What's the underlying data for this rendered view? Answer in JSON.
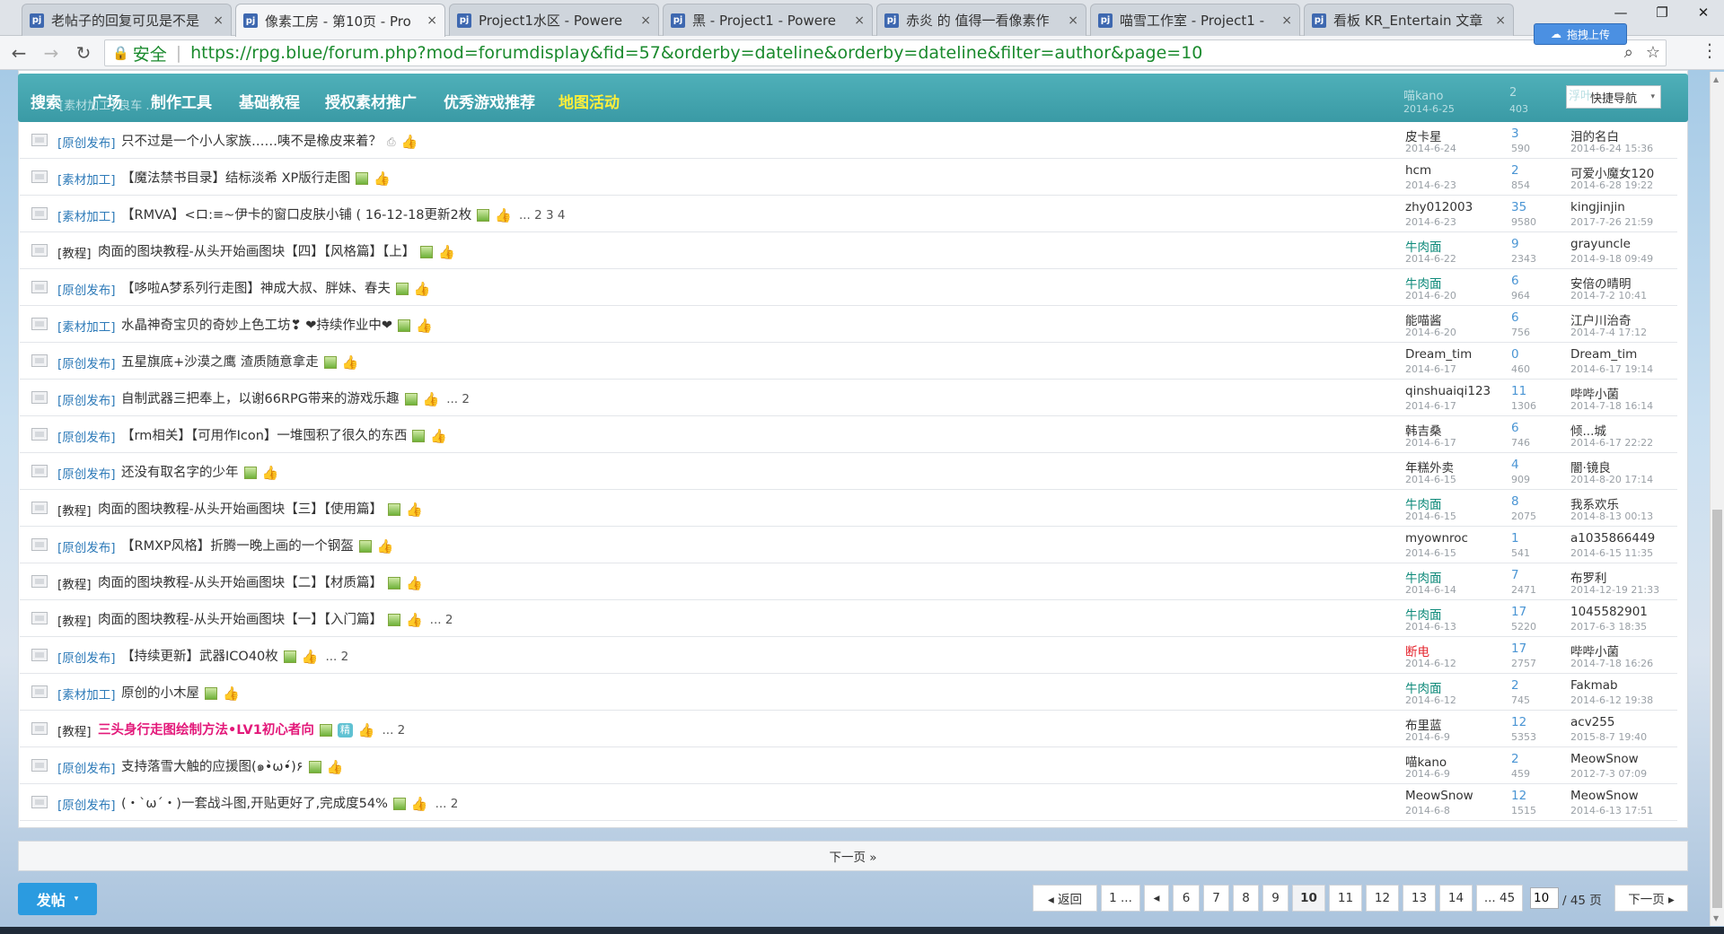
{
  "browser": {
    "tabs": [
      {
        "title": "老帖子的回复可见是不是"
      },
      {
        "title": "像素工房 - 第10页 - Pro",
        "active": true
      },
      {
        "title": "Project1水区 - Powere"
      },
      {
        "title": "黑 - Project1 - Powere"
      },
      {
        "title": "赤炎 的 值得一看像素作"
      },
      {
        "title": "喵雪工作室 - Project1 -"
      },
      {
        "title": "看板 KR_Entertain 文章"
      }
    ],
    "favicon": "pj",
    "close_glyph": "×",
    "window_controls": [
      "—",
      "❐",
      "✕"
    ],
    "upload_label": "拖拽上传",
    "back_glyph": "←",
    "forward_glyph": "→",
    "reload_glyph": "↻",
    "lock_glyph": "🔒",
    "secure_label": "安全",
    "url": "https://rpg.blue/forum.php?mod=forumdisplay&fid=57&orderby=dateline&orderby=dateline&filter=author&page=10",
    "search_glyph": "⌕",
    "star_glyph": "☆",
    "menu_glyph": "⋮"
  },
  "nav": {
    "items": [
      "搜索",
      "广场",
      "制作工具",
      "基础教程",
      "授权素材推广",
      "优秀游戏推荐",
      "地图活动"
    ],
    "quick_nav": "快捷导航",
    "ghost_top": [
      {
        "text": "喵kano",
        "kind": "au"
      },
      {
        "text": "2014-6-25",
        "kind": "ad"
      },
      {
        "text": "2",
        "kind": "rc"
      },
      {
        "text": "403",
        "kind": "vc"
      },
      {
        "text": "浮叶",
        "kind": "lu"
      },
      {
        "text": "[素材加工] 良车 ...",
        "kind": "cat"
      }
    ]
  },
  "threads": [
    {
      "cat": "[原创发布]",
      "subject": "只不过是一个小人家族……咦不是橡皮来着？",
      "marks": [
        "clip",
        "thumb"
      ],
      "author": "皮卡星",
      "date": "2014-6-24",
      "replies": "3",
      "views": "590",
      "last_user": "泪的名白",
      "last_time": "2014-6-24 15:36"
    },
    {
      "cat": "[素材加工]",
      "subject": "【魔法禁书目录】结标淡希 XP版行走图",
      "marks": [
        "img",
        "thumb"
      ],
      "author": "hcm",
      "date": "2014-6-23",
      "replies": "2",
      "views": "854",
      "last_user": "可爱小魔女120",
      "last_time": "2014-6-28 19:22"
    },
    {
      "cat": "[素材加工]",
      "subject": "【RMVA】<ロ:≡~伊卡的窗口皮肤小铺 ( 16-12-18更新2枚",
      "marks": [
        "img",
        "thumb"
      ],
      "pages": "... 2 3 4",
      "author": "zhy012003",
      "date": "2014-6-23",
      "replies": "35",
      "views": "9580",
      "last_user": "kingjinjin",
      "last_time": "2017-7-26 21:59"
    },
    {
      "cat": "[教程]",
      "subject": "肉面的图块教程-从头开始画图块【四】【风格篇】【上】",
      "marks": [
        "img",
        "thumb"
      ],
      "author": "牛肉面",
      "author_color": "teal",
      "date": "2014-6-22",
      "replies": "9",
      "views": "2343",
      "last_user": "grayuncle",
      "last_time": "2014-9-18 09:49"
    },
    {
      "cat": "[原创发布]",
      "subject": "【哆啦A梦系列行走图】神成大叔、胖妹、春夫",
      "marks": [
        "img",
        "thumb"
      ],
      "author": "牛肉面",
      "author_color": "teal",
      "date": "2014-6-20",
      "replies": "6",
      "views": "964",
      "last_user": "安倍の晴明",
      "last_time": "2014-7-2 10:41"
    },
    {
      "cat": "[素材加工]",
      "subject": "水晶神奇宝贝的奇妙上色工坊❣ ❤持续作业中❤",
      "marks": [
        "img",
        "thumb"
      ],
      "author": "能喵酱",
      "date": "2014-6-20",
      "replies": "6",
      "views": "756",
      "last_user": "江户川治奇",
      "last_time": "2014-7-4 17:12"
    },
    {
      "cat": "[原创发布]",
      "subject": "五星旗底+沙漠之鹰 渣质随意拿走",
      "marks": [
        "img",
        "thumb"
      ],
      "author": "Dream_tim",
      "date": "2014-6-17",
      "replies": "0",
      "views": "460",
      "last_user": "Dream_tim",
      "last_time": "2014-6-17 19:14"
    },
    {
      "cat": "[原创发布]",
      "subject": "自制武器三把奉上，以谢66RPG带来的游戏乐趣",
      "marks": [
        "img",
        "thumb"
      ],
      "pages": "... 2",
      "author": "qinshuaiqi123",
      "date": "2014-6-17",
      "replies": "11",
      "views": "1306",
      "last_user": "哔哔小菌",
      "last_time": "2014-7-18 16:14"
    },
    {
      "cat": "[原创发布]",
      "subject": "【rm相关】【可用作Icon】一堆囤积了很久的东西",
      "marks": [
        "img",
        "thumb"
      ],
      "author": "韩吉桑",
      "date": "2014-6-17",
      "replies": "6",
      "views": "746",
      "last_user": "倾...城",
      "last_time": "2014-6-17 22:22"
    },
    {
      "cat": "[原创发布]",
      "subject": "还没有取名字的少年",
      "marks": [
        "img",
        "thumb"
      ],
      "author": "年糕外卖",
      "date": "2014-6-15",
      "replies": "4",
      "views": "909",
      "last_user": "闇·镜良",
      "last_time": "2014-8-20 17:14"
    },
    {
      "cat": "[教程]",
      "subject": "肉面的图块教程-从头开始画图块【三】【使用篇】",
      "marks": [
        "img",
        "thumb"
      ],
      "author": "牛肉面",
      "author_color": "teal",
      "date": "2014-6-15",
      "replies": "8",
      "views": "2075",
      "last_user": "我系欢乐",
      "last_time": "2014-8-13 00:13"
    },
    {
      "cat": "[原创发布]",
      "subject": "【RMXP风格】折腾一晚上画的一个钢盔",
      "marks": [
        "img",
        "thumb"
      ],
      "author": "myownroc",
      "date": "2014-6-15",
      "replies": "1",
      "views": "541",
      "last_user": "a1035866449",
      "last_time": "2014-6-15 11:35"
    },
    {
      "cat": "[教程]",
      "subject": "肉面的图块教程-从头开始画图块【二】【材质篇】",
      "marks": [
        "img",
        "thumb"
      ],
      "author": "牛肉面",
      "author_color": "teal",
      "date": "2014-6-14",
      "replies": "7",
      "views": "2471",
      "last_user": "布罗利",
      "last_time": "2014-12-19 21:33"
    },
    {
      "cat": "[教程]",
      "subject": "肉面的图块教程-从头开始画图块【一】【入门篇】",
      "marks": [
        "img",
        "thumb"
      ],
      "pages": "... 2",
      "author": "牛肉面",
      "author_color": "teal",
      "date": "2014-6-13",
      "replies": "17",
      "views": "5220",
      "last_user": "1045582901",
      "last_time": "2017-6-3 18:35"
    },
    {
      "cat": "[原创发布]",
      "subject": "【持续更新】武器ICO40枚",
      "marks": [
        "img",
        "thumb"
      ],
      "pages": "... 2",
      "author": "断电",
      "author_color": "red",
      "date": "2014-6-12",
      "replies": "17",
      "views": "2757",
      "last_user": "哔哔小菌",
      "last_time": "2014-7-18 16:26"
    },
    {
      "cat": "[素材加工]",
      "subject": "原创的小木屋",
      "marks": [
        "img",
        "thumb"
      ],
      "author": "牛肉面",
      "author_color": "teal",
      "date": "2014-6-12",
      "replies": "2",
      "views": "745",
      "last_user": "Fakmab",
      "last_time": "2014-6-12 19:38"
    },
    {
      "cat": "[教程]",
      "subject": "三头身行走图绘制方法•LV1初心者向",
      "subject_color": "pink",
      "marks": [
        "img",
        "best",
        "thumb"
      ],
      "best_label": "精",
      "pages": "... 2",
      "author": "布里蓝",
      "date": "2014-6-9",
      "replies": "12",
      "views": "5353",
      "last_user": "acv255",
      "last_time": "2015-8-7 19:40"
    },
    {
      "cat": "[原创发布]",
      "subject": "支持落雪大触的应援图(๑•̀ω•́)۶",
      "marks": [
        "img",
        "thumb"
      ],
      "author": "喵kano",
      "date": "2014-6-9",
      "replies": "2",
      "views": "459",
      "last_user": "MeowSnow",
      "last_time": "2012-7-3 07:09"
    },
    {
      "cat": "[原创发布]",
      "subject": "(・`ω´・)一套战斗图,开贴更好了,完成度54%",
      "marks": [
        "img",
        "thumb"
      ],
      "pages": "... 2",
      "author": "MeowSnow",
      "date": "2014-6-8",
      "replies": "12",
      "views": "1515",
      "last_user": "MeowSnow",
      "last_time": "2014-6-13 17:51"
    }
  ],
  "next_page_label": "下一页 »",
  "post_button": {
    "label": "发帖",
    "arrow": "▾"
  },
  "pagination": {
    "back": "◂ 返回",
    "first": "1 ...",
    "prev": "◂",
    "pages": [
      "6",
      "7",
      "8",
      "9",
      "10",
      "11",
      "12",
      "13",
      "14"
    ],
    "current": "10",
    "last": "... 45",
    "input_value": "10",
    "total": "/ 45 页",
    "next": "下一页 ▸"
  },
  "marks": {
    "clip": "⎙",
    "thumb": "👍"
  },
  "colors": {
    "nav_bg": "#40a4ae",
    "nav_highlight": "#ffef3a",
    "link_blue": "#2d7ab8",
    "teal_author": "#0e8a7a",
    "red_author": "#e4242d",
    "pink_subject": "#e3197a"
  }
}
